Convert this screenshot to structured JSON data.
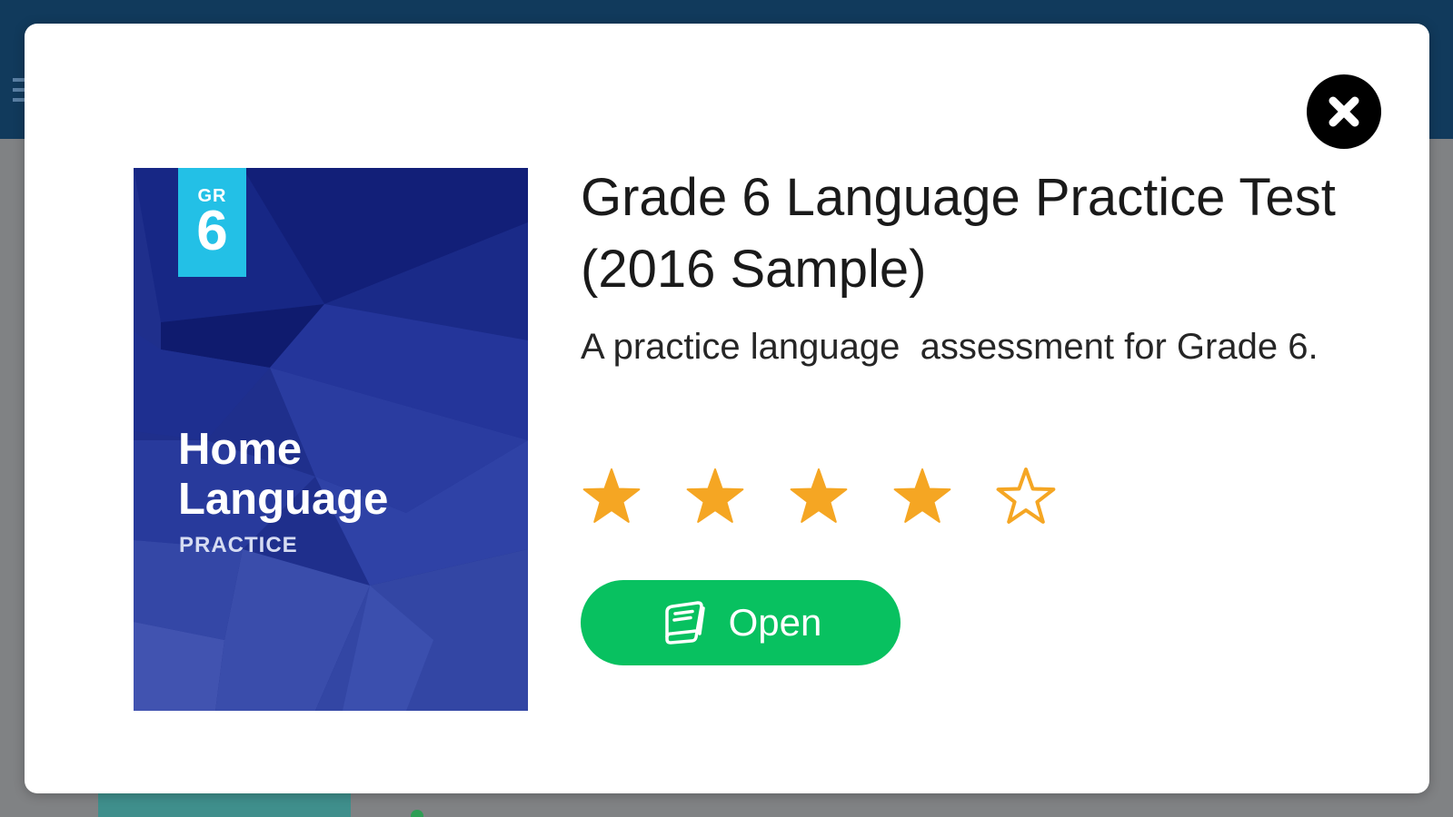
{
  "modal": {
    "title": "Grade 6 Language Practice Test (2016 Sample)",
    "description": "A practice language  assessment for Grade 6.",
    "close_icon": "close-icon",
    "rating": {
      "value": 4,
      "max": 5,
      "star_color": "#f5a623"
    },
    "open_button": {
      "label": "Open",
      "icon": "book-icon",
      "color": "#08c160"
    }
  },
  "cover": {
    "grade_prefix": "GR",
    "grade_number": "6",
    "title": "Home Language",
    "subtitle": "PRACTICE",
    "badge_color": "#23c0e6",
    "background_color": "#1d2d8a"
  },
  "background": {
    "header_color": "#113a5c",
    "menu_icon": "hamburger-menu-icon"
  }
}
